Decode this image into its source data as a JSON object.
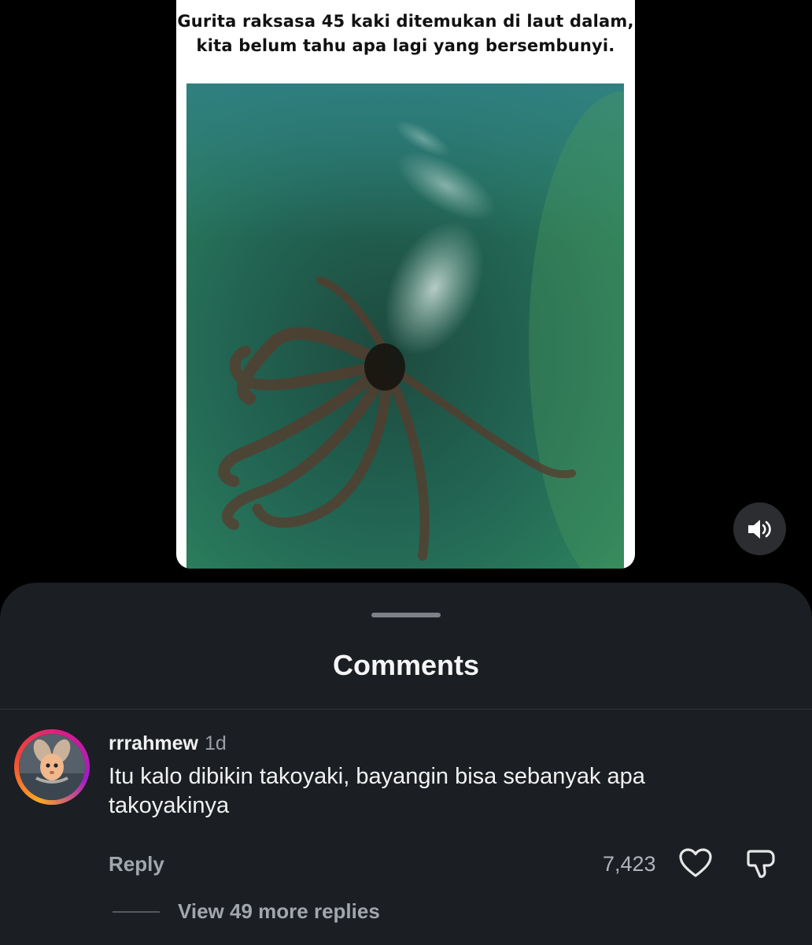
{
  "post": {
    "caption": "Gurita raksasa 45 kaki ditemukan di laut dalam,\nkita belum tahu apa lagi yang bersembunyi.",
    "sound_icon": "speaker-icon"
  },
  "sheet": {
    "title": "Comments"
  },
  "comment": {
    "username": "rrrahmew",
    "time": "1d",
    "text": "Itu kalo dibikin takoyaki, bayangin bisa sebanyak apa takoyakinya",
    "reply_label": "Reply",
    "like_count": "7,423",
    "view_replies": "View 49 more replies"
  },
  "colors": {
    "sheet_bg": "#1b1e22",
    "text_primary": "#f1f1f1",
    "text_secondary": "#a2a6ad"
  }
}
